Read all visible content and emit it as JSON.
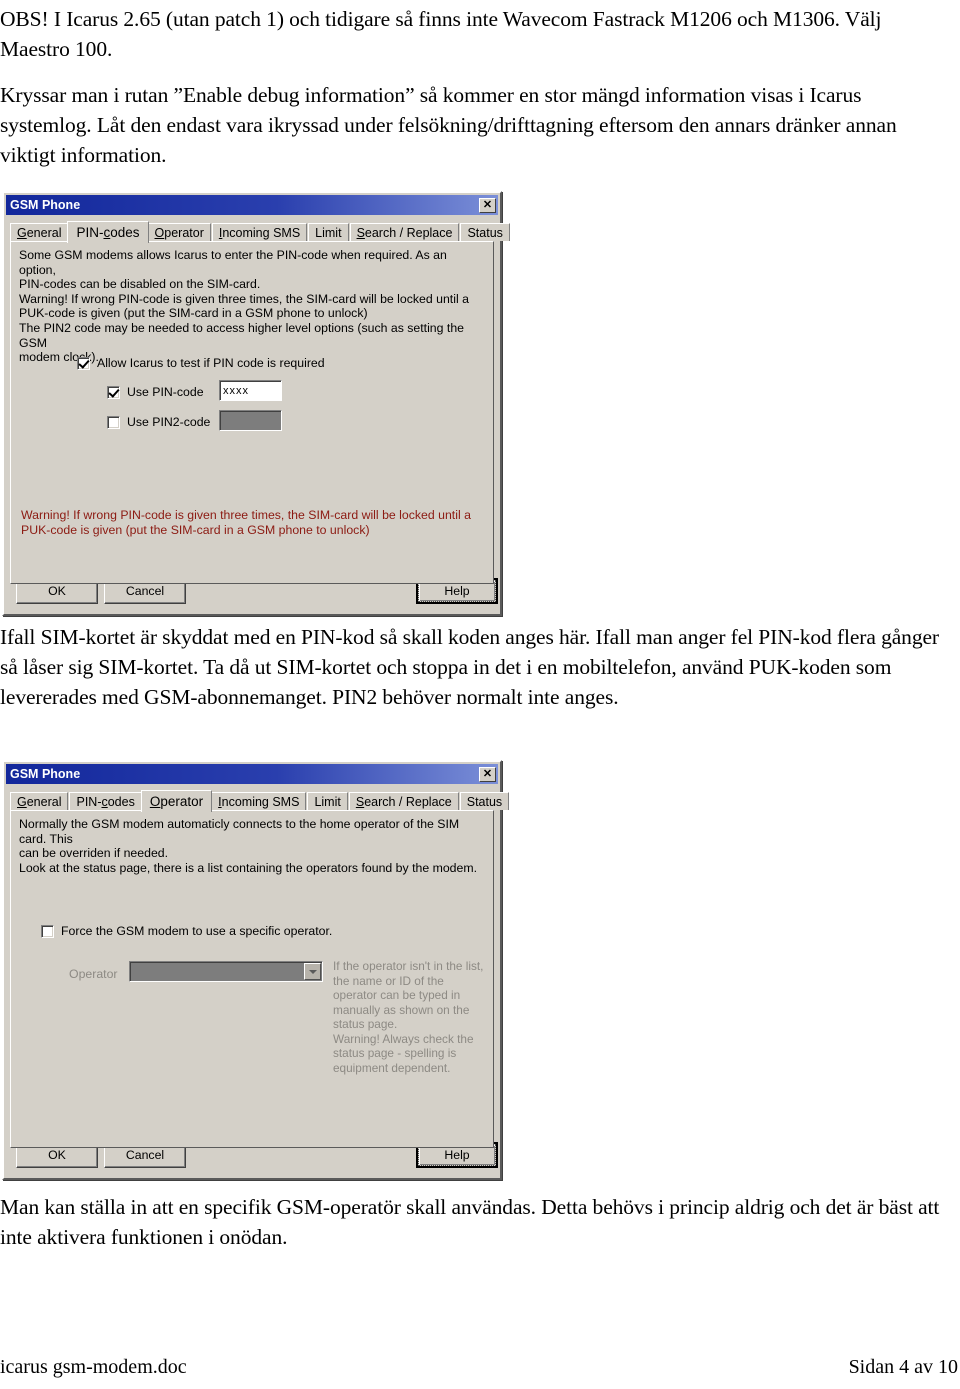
{
  "document": {
    "paragraphs": {
      "intro": "OBS! I Icarus 2.65 (utan patch 1) och tidigare så finns inte Wavecom Fastrack M1206 och M1306. Välj Maestro 100.",
      "debug": "Kryssar man i rutan ”Enable debug information” så kommer en stor mängd information visas i Icarus systemlog. Låt den endast vara ikryssad under felsökning/drifttagning eftersom den annars dränker annan viktigt information.",
      "pin_note": "Ifall SIM-kortet är skyddat med en PIN-kod så skall koden anges här. Ifall man anger fel PIN-kod flera gånger så låser sig SIM-kortet. Ta då ut SIM-kortet och stoppa in det i en mobiltelefon, använd PUK-koden som levererades med GSM-abonnemanget.\nPIN2 behöver normalt inte anges.",
      "operator_note": "Man kan ställa in att en specifik GSM-operatör skall användas. Detta behövs i princip aldrig och det är bäst att inte aktivera funktionen i onödan."
    },
    "footer": {
      "file_name": "icarus gsm-modem.doc",
      "page_label": "Sidan 4 av 10"
    }
  },
  "colors": {
    "titlebar_start": "#12279b",
    "titlebar_end": "#7b8fd8",
    "dialog_face": "#d4d0c8",
    "warning_text": "#8c1a12",
    "disabled_text": "#8d8a84",
    "disabled_field": "#7d7d7d"
  },
  "dialog_pin": {
    "title": "GSM Phone",
    "close_glyph": "✕",
    "tabs": [
      {
        "label": "General",
        "accel": "G",
        "selected": false
      },
      {
        "label": "PIN-codes",
        "accel": "c",
        "selected": true
      },
      {
        "label": "Operator",
        "accel": "O",
        "selected": false
      },
      {
        "label": "Incoming SMS",
        "accel": "I",
        "selected": false
      },
      {
        "label": "Limit",
        "accel": "",
        "selected": false
      },
      {
        "label": "Search / Replace",
        "accel": "S",
        "selected": false
      },
      {
        "label": "Status",
        "accel": "",
        "selected": false
      }
    ],
    "description": "Some GSM modems allows Icarus to enter the PIN-code when required. As an option,\nPIN-codes can be disabled on the SIM-card.\nWarning! If wrong PIN-code is given three times, the SIM-card will be locked until a\nPUK-code is given (put the SIM-card in a GSM phone to unlock)\nThe PIN2 code may be needed to access higher level options (such as setting the GSM\nmodem clock).",
    "controls": {
      "allow_test_label": "Allow Icarus to test if PIN code is required",
      "allow_test_checked": true,
      "use_pin_label": "Use PIN-code",
      "use_pin_checked": true,
      "pin_value": "xxxx",
      "use_pin2_label": "Use PIN2-code",
      "use_pin2_checked": false,
      "pin2_value": ""
    },
    "warning": "Warning! If wrong PIN-code is given three times, the SIM-card will be locked until a\nPUK-code is given (put the SIM-card in a GSM phone to unlock)",
    "buttons": {
      "ok": "OK",
      "cancel": "Cancel",
      "help": "Help"
    }
  },
  "dialog_operator": {
    "title": "GSM Phone",
    "close_glyph": "✕",
    "tabs": [
      {
        "label": "General",
        "accel": "G",
        "selected": false
      },
      {
        "label": "PIN-codes",
        "accel": "c",
        "selected": false
      },
      {
        "label": "Operator",
        "accel": "O",
        "selected": true
      },
      {
        "label": "Incoming SMS",
        "accel": "I",
        "selected": false
      },
      {
        "label": "Limit",
        "accel": "",
        "selected": false
      },
      {
        "label": "Search / Replace",
        "accel": "S",
        "selected": false
      },
      {
        "label": "Status",
        "accel": "",
        "selected": false
      }
    ],
    "description": "Normally the GSM modem automaticly connects to the home operator of the SIM card. This\ncan be overriden if needed.\nLook at the status page, there is a list containing the operators found by the modem.",
    "controls": {
      "force_operator_label": "Force the GSM modem to use a specific operator.",
      "force_operator_checked": false,
      "operator_field_label": "Operator",
      "operator_value": "",
      "side_note": "If the operator isn't in the list,\nthe name or ID of the\noperator can be typed in\nmanually as shown on the\nstatus page.\nWarning! Always check the\nstatus page - spelling is\nequipment dependent."
    },
    "buttons": {
      "ok": "OK",
      "cancel": "Cancel",
      "help": "Help"
    }
  }
}
